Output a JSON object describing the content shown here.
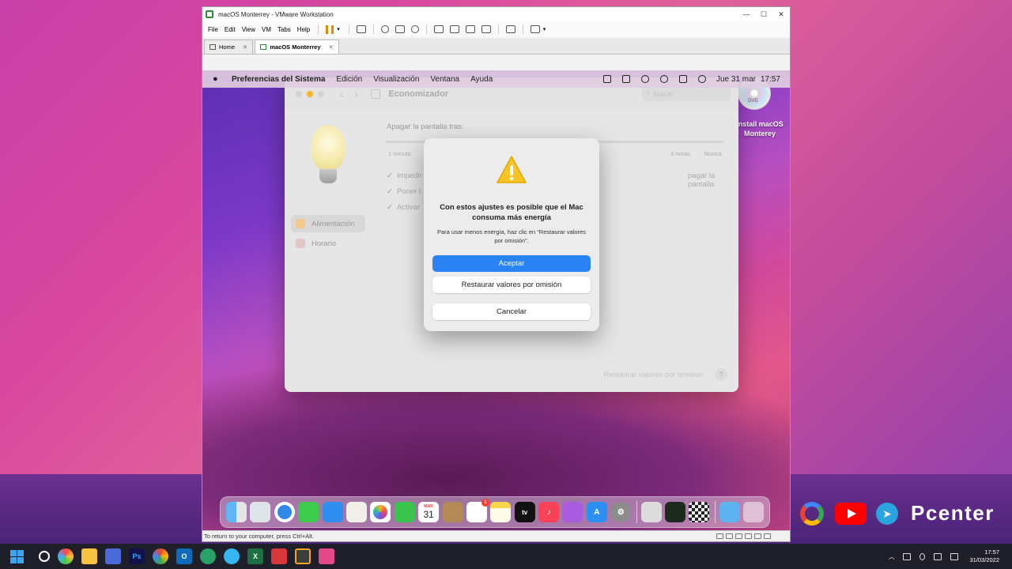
{
  "vmware": {
    "title": "macOS Monterrey - VMware Workstation",
    "menu": [
      "File",
      "Edit",
      "View",
      "VM",
      "Tabs",
      "Help"
    ],
    "tabs": [
      {
        "label": "Home"
      },
      {
        "label": "macOS Monterrey"
      }
    ],
    "status_text": "To return to your computer, press Ctrl+Alt."
  },
  "mac_menubar": {
    "app": "Preferencias del Sistema",
    "items": [
      "Edición",
      "Visualización",
      "Ventana",
      "Ayuda"
    ],
    "date": "Jue 31 mar",
    "time": "17:57"
  },
  "prefs": {
    "title": "Economizador",
    "search_placeholder": "Buscar",
    "sidebar": [
      {
        "label": "Alimentación",
        "selected": true
      },
      {
        "label": "Horario",
        "selected": false
      }
    ],
    "turn_off_label": "Apagar la pantalla tras:",
    "slider_labels": {
      "min": "1 minuto",
      "h3": "3 horas",
      "never": "Nunca"
    },
    "checkboxes": [
      {
        "label": "Impedir",
        "checked": true
      },
      {
        "label": "Poner l",
        "checked": true
      },
      {
        "label": "Activar",
        "checked": true
      }
    ],
    "checkbox_tail": "pagar la pantalla",
    "restore_link": "Restaurar valores por omisión",
    "help": "?"
  },
  "alert": {
    "title": "Con estos ajustes es posible que el Mac consuma más energía",
    "message": "Para usar menos energía, haz clic en “Restaurar valores por omisión”.",
    "buttons": {
      "accept": "Aceptar",
      "restore": "Restaurar valores por omisión",
      "cancel": "Cancelar"
    }
  },
  "desktop": {
    "dvd_label": "Install macOS Monterey",
    "dvd_tag": "DVD"
  },
  "dock": {
    "calendar_month": "MAR",
    "calendar_day": "31",
    "reminders_badge": "1",
    "tv_label": "tv"
  },
  "brand": {
    "name": "Pcenter"
  },
  "taskbar": {
    "time": "17:57",
    "date": "31/03/2022"
  },
  "colors": {
    "accent": "#2a83f5",
    "warning": "#f7c325"
  }
}
